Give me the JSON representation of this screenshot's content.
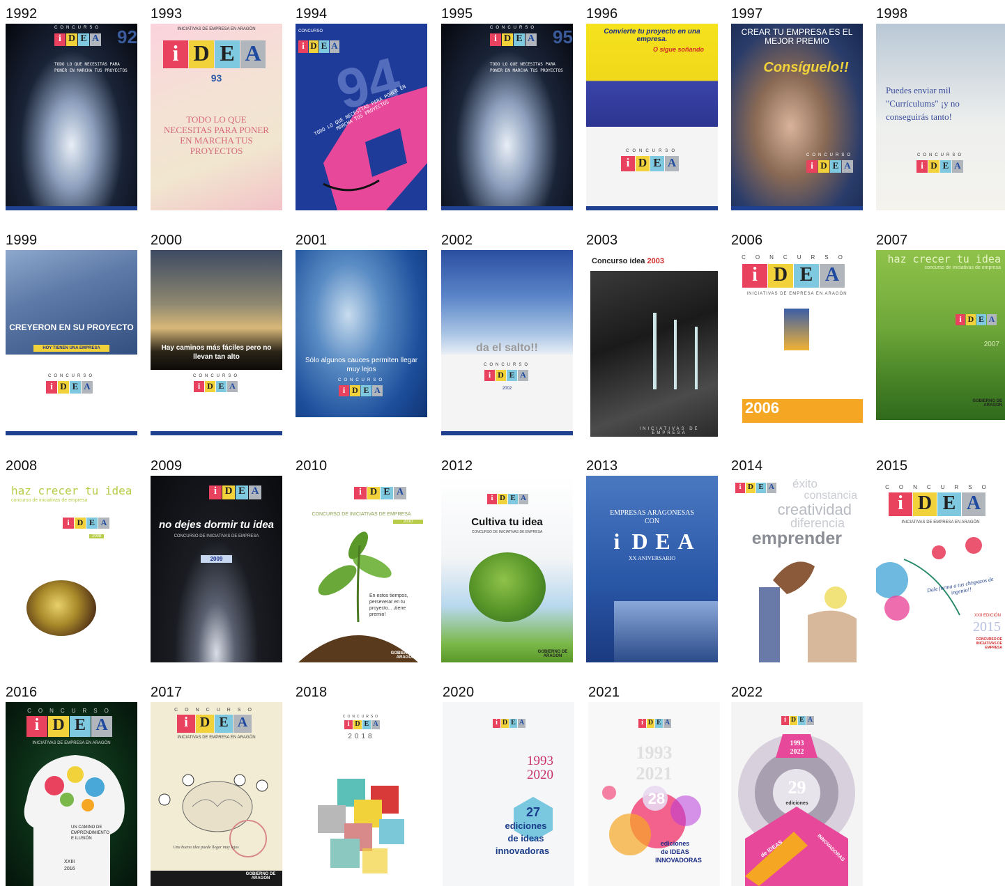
{
  "rows": [
    [
      {
        "year": "1992",
        "texts": [
          "CONCURSO",
          "92",
          "TODO LO QUE NECESITAS PARA PONER EN MARCHA TUS PROYECTOS"
        ]
      },
      {
        "year": "1993",
        "texts": [
          "INICIATIVAS DE EMPRESA EN ARAGÓN",
          "93",
          "TODO LO QUE NECESITAS PARA PONER EN MARCHA TUS PROYECTOS"
        ]
      },
      {
        "year": "1994",
        "texts": [
          "CONCURSO",
          "94",
          "TODO LO QUE NECESITAS PARA PONER EN MARCHA TUS PROYECTOS"
        ]
      },
      {
        "year": "1995",
        "texts": [
          "CONCURSO",
          "95",
          "TODO LO QUE NECESITAS PARA PONER EN MARCHA TUS PROYECTOS"
        ]
      },
      {
        "year": "1996",
        "texts": [
          "Convierte tu proyecto en una empresa.",
          "O sigue soñando",
          "CONCURSO"
        ]
      },
      {
        "year": "1997",
        "texts": [
          "CREAR TU EMPRESA ES EL MEJOR PREMIO",
          "Consíguelo!!",
          "CONCURSO"
        ]
      },
      {
        "year": "1998",
        "texts": [
          "Puedes enviar mil \"Currículums\" ¡y no conseguirás tanto!",
          "CONCURSO"
        ]
      }
    ],
    [
      {
        "year": "1999",
        "texts": [
          "CREYERON EN SU PROYECTO",
          "HOY TIENEN UNA EMPRESA",
          "CONCURSO"
        ]
      },
      {
        "year": "2000",
        "texts": [
          "Hay caminos más fáciles pero no llevan tan alto",
          "CONCURSO"
        ]
      },
      {
        "year": "2001",
        "texts": [
          "Sólo algunos cauces permiten llegar muy lejos",
          "CONCURSO"
        ]
      },
      {
        "year": "2002",
        "texts": [
          "da el salto!!",
          "CONCURSO",
          "2002"
        ]
      },
      {
        "year": "2003",
        "texts": [
          "Concurso idea",
          "2003",
          "INICIATIVAS DE EMPRESA"
        ]
      },
      {
        "year": "2006",
        "texts": [
          "CONCURSO",
          "INICIATIVAS DE EMPRESA EN ARAGÓN",
          "2006"
        ]
      },
      {
        "year": "2007",
        "texts": [
          "haz crecer tu idea",
          "concurso de iniciativas de empresa",
          "2007",
          "GOBIERNO DE ARAGON"
        ]
      }
    ],
    [
      {
        "year": "2008",
        "texts": [
          "haz crecer tu idea",
          "concurso de iniciativas de empresa",
          "2008"
        ]
      },
      {
        "year": "2009",
        "texts": [
          "no dejes dormir tu idea",
          "CONCURSO DE INICIATIVAS DE EMPRESA",
          "2009"
        ]
      },
      {
        "year": "2010",
        "texts": [
          "CONCURSO DE INICIATIVAS DE EMPRESA",
          "2010",
          "En estos tiempos, perseverar en tu proyecto... ¡tiene premio!",
          "GOBIERNO DE ARAGON"
        ]
      },
      {
        "year": "2012",
        "texts": [
          "Cultiva tu idea",
          "CONCURSO DE INICIATIVAS DE EMPRESA",
          "GOBIERNO DE ARAGON"
        ]
      },
      {
        "year": "2013",
        "texts": [
          "EMPRESAS ARAGONESAS CON",
          "XX ANIVERSARIO"
        ]
      },
      {
        "year": "2014",
        "texts": [
          "éxito",
          "constancia",
          "creatividad",
          "diferencia",
          "emprender"
        ]
      },
      {
        "year": "2015",
        "texts": [
          "CONCURSO",
          "INICIATIVAS DE EMPRESA EN ARAGÓN",
          "Dale forma a tus chispazos de ingenio!!",
          "XXII EDICIÓN",
          "2015",
          "CONCURSO DE INICIATIVAS DE EMPRESA"
        ]
      }
    ],
    [
      {
        "year": "2016",
        "texts": [
          "CONCURSO",
          "INICIATIVAS DE EMPRESA EN ARAGÓN",
          "UN CAMINO DE EMPRENDIMIENTO E ILUSIÓN",
          "XXIII",
          "2016"
        ]
      },
      {
        "year": "2017",
        "texts": [
          "CONCURSO",
          "INICIATIVAS DE EMPRESA EN ARAGÓN",
          "Una buena idea puede llegar muy lejos",
          "GOBIERNO DE ARAGON"
        ]
      },
      {
        "year": "2018",
        "texts": [
          "CONCURSO",
          "2018"
        ]
      },
      {
        "year": "2020",
        "texts": [
          "1993",
          "2020",
          "27",
          "ediciones",
          "de ideas",
          "innovadoras"
        ]
      },
      {
        "year": "2021",
        "texts": [
          "1993",
          "2021",
          "28",
          "ediciones",
          "de IDEAS",
          "INNOVADORAS"
        ]
      },
      {
        "year": "2022",
        "texts": [
          "1993",
          "2022",
          "29",
          "ediciones",
          "de IDEAS",
          "INNOVADORAS"
        ]
      }
    ]
  ],
  "logo_letters": [
    "i",
    "D",
    "E",
    "A"
  ],
  "colors": {
    "logo_pink": "#e9425f",
    "logo_yellow": "#f2d23a",
    "logo_cyan": "#7ec9e0",
    "logo_grey": "#b0b6bc",
    "aragon_red": "#c8102e"
  }
}
